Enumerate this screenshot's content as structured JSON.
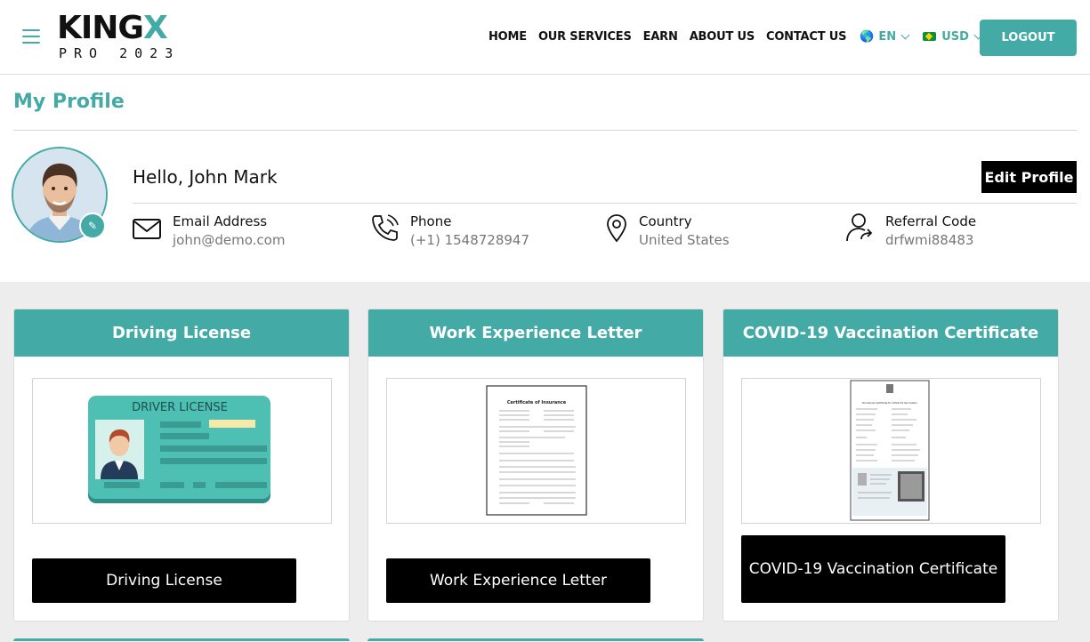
{
  "header": {
    "logo": {
      "main": "KING",
      "main_accent": "X",
      "sub": "PRO 2023"
    },
    "nav": [
      "HOME",
      "OUR SERVICES",
      "EARN",
      "ABOUT US",
      "CONTACT US"
    ],
    "language": "EN",
    "currency": "USD",
    "logout_label": "LOGOUT",
    "accent_color": "#44aaa6"
  },
  "profile": {
    "title": "My Profile",
    "greeting": "Hello, John Mark",
    "edit_label": "Edit Profile",
    "fields": [
      {
        "label": "Email Address",
        "value": "john@demo.com",
        "icon": "mail-icon"
      },
      {
        "label": "Phone",
        "value": "(+1) 1548728947",
        "icon": "phone-icon"
      },
      {
        "label": "Country",
        "value": "United States",
        "icon": "location-pin-icon"
      },
      {
        "label": "Referral Code",
        "value": "drfwmi88483",
        "icon": "referral-user-icon"
      }
    ]
  },
  "documents": [
    {
      "title": "Driving License",
      "button": "Driving License",
      "thumb_text": "DRIVER LICENSE"
    },
    {
      "title": "Work Experience Letter",
      "button": "Work Experience Letter",
      "thumb_text": "Certificate of Insurance"
    },
    {
      "title": "COVID-19 Vaccination Certificate",
      "button": "COVID-19 Vaccination Certificate",
      "thumb_text": "Provisional Certificate for COVID-19 Vaccination"
    }
  ]
}
